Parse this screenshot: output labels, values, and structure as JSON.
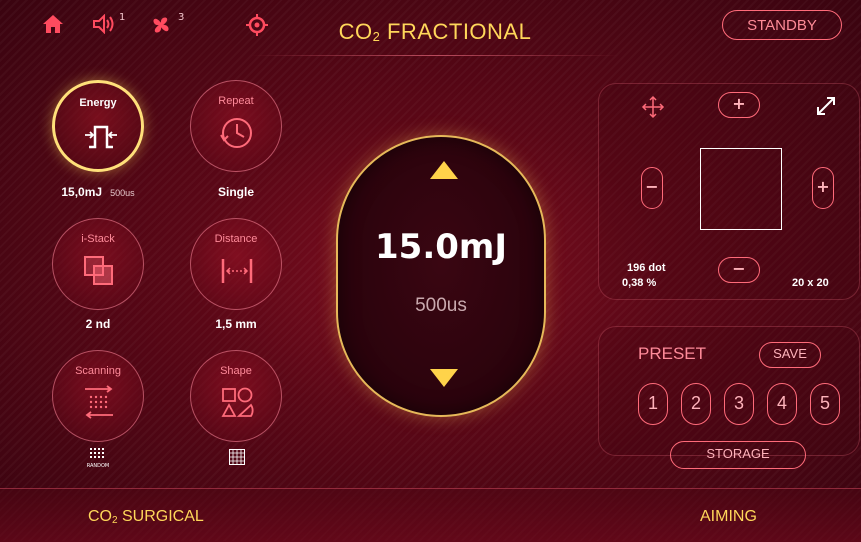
{
  "header": {
    "title_main": "CO",
    "title_sub": "2",
    "title_rest": " FRACTIONAL",
    "sound_level": "1",
    "fan_level": "3",
    "standby_label": "STANDBY",
    "icons": [
      "home-icon",
      "speaker-icon",
      "fan-icon",
      "target-icon"
    ]
  },
  "modes": {
    "energy": {
      "label": "Energy",
      "value": "15,0mJ",
      "sub_value": "500us"
    },
    "repeat": {
      "label": "Repeat",
      "value": "Single"
    },
    "istack": {
      "label": "i-Stack",
      "value": "2 nd"
    },
    "distance": {
      "label": "Distance",
      "value": "1,5 mm"
    },
    "scanning": {
      "label": "Scanning",
      "sub_label": "RANDOM"
    },
    "shape": {
      "label": "Shape"
    }
  },
  "center": {
    "energy_value": "15.0mJ",
    "pulse_value": "500us"
  },
  "pattern": {
    "plus_label": "+",
    "minus_label": "−",
    "dot_count": "196 dot",
    "density": "0,38 %",
    "size": "20 x 20"
  },
  "preset": {
    "title": "PRESET",
    "save_label": "SAVE",
    "numbers": [
      "1",
      "2",
      "3",
      "4",
      "5"
    ],
    "storage_label": "STORAGE"
  },
  "footer": {
    "left_main": "CO",
    "left_sub": "2",
    "left_rest": " SURGICAL",
    "right_label": "AIMING"
  },
  "colors": {
    "accent_gold": "#ffd75a",
    "accent_red": "#ff6b7a",
    "background": "#5a0716"
  }
}
